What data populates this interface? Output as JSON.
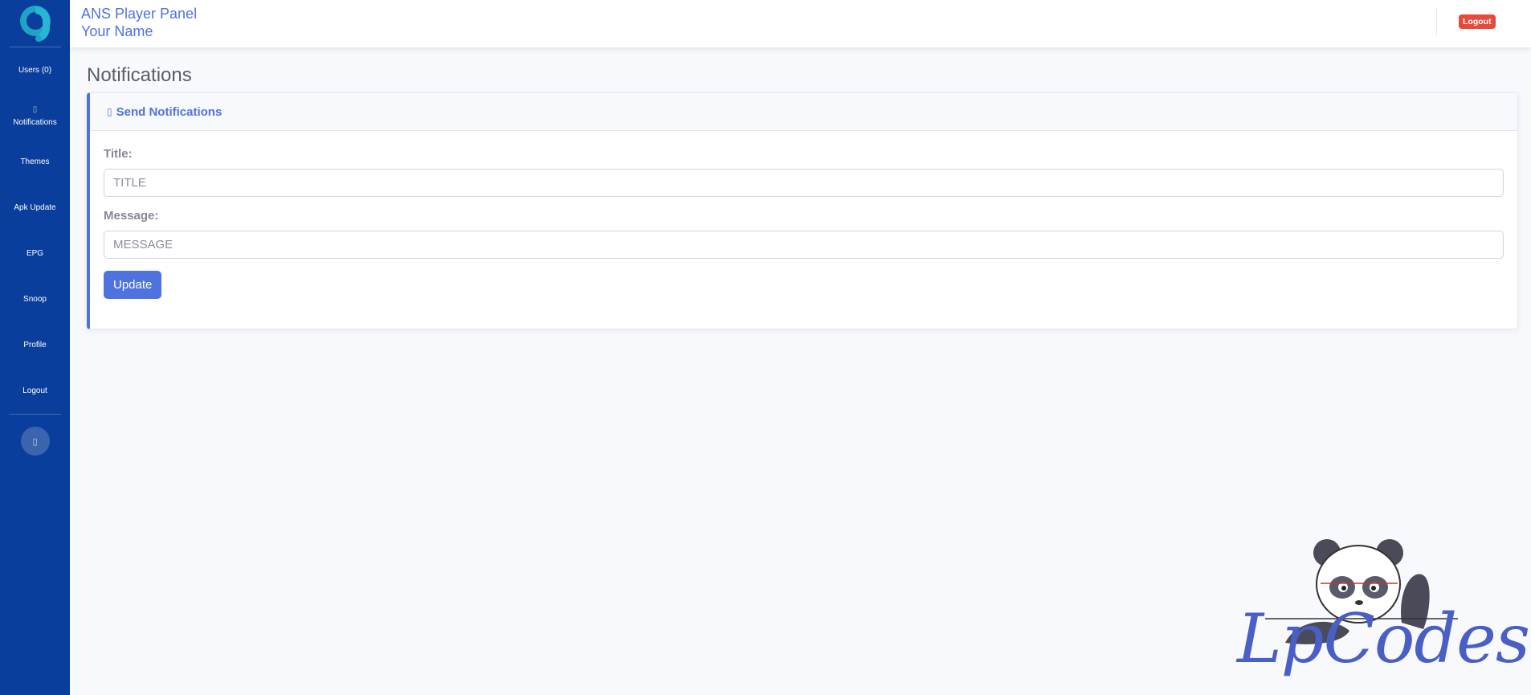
{
  "app": {
    "title": "ANS Player Panel",
    "user_name": "Your Name",
    "logout_label": "Logout"
  },
  "sidebar": {
    "items": [
      {
        "label": "Users (0)",
        "icon": ""
      },
      {
        "label": "Notifications",
        "icon": "bell-icon"
      },
      {
        "label": "Themes",
        "icon": ""
      },
      {
        "label": "Apk Update",
        "icon": ""
      },
      {
        "label": "EPG",
        "icon": ""
      },
      {
        "label": "Snoop",
        "icon": ""
      },
      {
        "label": "Profile",
        "icon": ""
      },
      {
        "label": "Logout",
        "icon": ""
      }
    ],
    "toggle_icon": "chevron-left-icon"
  },
  "page": {
    "heading": "Notifications"
  },
  "card": {
    "header": "Send Notifications",
    "header_icon": "bell-icon",
    "title_label": "Title:",
    "title_placeholder": "TITLE",
    "message_label": "Message:",
    "message_placeholder": "MESSAGE",
    "submit_label": "Update"
  },
  "watermark": {
    "text": "LpCodes"
  },
  "colors": {
    "sidebar": "#0a3e9c",
    "primary": "#4e73df",
    "danger": "#e74a3b",
    "background": "#f8f9fc"
  }
}
